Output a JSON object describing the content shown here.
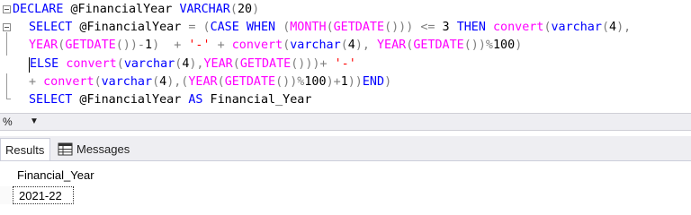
{
  "editor": {
    "lines": [
      [
        {
          "t": "DECLARE",
          "c": "kw"
        },
        {
          "t": " @FinancialYear ",
          "c": ""
        },
        {
          "t": "VARCHAR",
          "c": "kw"
        },
        {
          "t": "(",
          "c": "op"
        },
        {
          "t": "20",
          "c": ""
        },
        {
          "t": ")",
          "c": "op"
        }
      ],
      [
        {
          "t": "SELECT",
          "c": "kw"
        },
        {
          "t": " @FinancialYear ",
          "c": ""
        },
        {
          "t": "=",
          "c": "op"
        },
        {
          "t": " ",
          "c": ""
        },
        {
          "t": "(",
          "c": "op"
        },
        {
          "t": "CASE WHEN",
          "c": "kw"
        },
        {
          "t": " ",
          "c": ""
        },
        {
          "t": "(",
          "c": "op"
        },
        {
          "t": "MONTH",
          "c": "fn"
        },
        {
          "t": "(",
          "c": "op"
        },
        {
          "t": "GETDATE",
          "c": "fn"
        },
        {
          "t": "()))",
          "c": "op"
        },
        {
          "t": " ",
          "c": ""
        },
        {
          "t": "<=",
          "c": "op"
        },
        {
          "t": " 3 ",
          "c": ""
        },
        {
          "t": "THEN",
          "c": "kw"
        },
        {
          "t": " ",
          "c": ""
        },
        {
          "t": "convert",
          "c": "fn"
        },
        {
          "t": "(",
          "c": "op"
        },
        {
          "t": "varchar",
          "c": "kw"
        },
        {
          "t": "(",
          "c": "op"
        },
        {
          "t": "4",
          "c": ""
        },
        {
          "t": "),",
          "c": "op"
        }
      ],
      [
        {
          "t": "YEAR",
          "c": "fn"
        },
        {
          "t": "(",
          "c": "op"
        },
        {
          "t": "GETDATE",
          "c": "fn"
        },
        {
          "t": "())-",
          "c": "op"
        },
        {
          "t": "1",
          "c": ""
        },
        {
          "t": ")",
          "c": "op"
        },
        {
          "t": "  ",
          "c": ""
        },
        {
          "t": "+",
          "c": "op"
        },
        {
          "t": " ",
          "c": ""
        },
        {
          "t": "'-'",
          "c": "str"
        },
        {
          "t": " ",
          "c": ""
        },
        {
          "t": "+",
          "c": "op"
        },
        {
          "t": " ",
          "c": ""
        },
        {
          "t": "convert",
          "c": "fn"
        },
        {
          "t": "(",
          "c": "op"
        },
        {
          "t": "varchar",
          "c": "kw"
        },
        {
          "t": "(",
          "c": "op"
        },
        {
          "t": "4",
          "c": ""
        },
        {
          "t": "),",
          "c": "op"
        },
        {
          "t": " ",
          "c": ""
        },
        {
          "t": "YEAR",
          "c": "fn"
        },
        {
          "t": "(",
          "c": "op"
        },
        {
          "t": "GETDATE",
          "c": "fn"
        },
        {
          "t": "())%",
          "c": "op"
        },
        {
          "t": "100",
          "c": ""
        },
        {
          "t": ")",
          "c": "op"
        }
      ],
      [
        {
          "t": "ELSE",
          "c": "kw"
        },
        {
          "t": " ",
          "c": ""
        },
        {
          "t": "convert",
          "c": "fn"
        },
        {
          "t": "(",
          "c": "op"
        },
        {
          "t": "varchar",
          "c": "kw"
        },
        {
          "t": "(",
          "c": "op"
        },
        {
          "t": "4",
          "c": ""
        },
        {
          "t": "),",
          "c": "op"
        },
        {
          "t": "YEAR",
          "c": "fn"
        },
        {
          "t": "(",
          "c": "op"
        },
        {
          "t": "GETDATE",
          "c": "fn"
        },
        {
          "t": "()))+",
          "c": "op"
        },
        {
          "t": " ",
          "c": ""
        },
        {
          "t": "'-'",
          "c": "str"
        }
      ],
      [
        {
          "t": "+",
          "c": "op"
        },
        {
          "t": " ",
          "c": ""
        },
        {
          "t": "convert",
          "c": "fn"
        },
        {
          "t": "(",
          "c": "op"
        },
        {
          "t": "varchar",
          "c": "kw"
        },
        {
          "t": "(",
          "c": "op"
        },
        {
          "t": "4",
          "c": ""
        },
        {
          "t": "),(",
          "c": "op"
        },
        {
          "t": "YEAR",
          "c": "fn"
        },
        {
          "t": "(",
          "c": "op"
        },
        {
          "t": "GETDATE",
          "c": "fn"
        },
        {
          "t": "())%",
          "c": "op"
        },
        {
          "t": "100",
          "c": ""
        },
        {
          "t": ")+",
          "c": "op"
        },
        {
          "t": "1",
          "c": ""
        },
        {
          "t": "))",
          "c": "op"
        },
        {
          "t": "END",
          "c": "kw"
        },
        {
          "t": ")",
          "c": "op"
        }
      ],
      [
        {
          "t": "SELECT",
          "c": "kw"
        },
        {
          "t": " @FinancialYear ",
          "c": ""
        },
        {
          "t": "AS",
          "c": "kw"
        },
        {
          "t": " Financial_Year",
          "c": ""
        }
      ]
    ]
  },
  "zoom": {
    "value": "%",
    "arrow_icon": "dropdown-arrow-icon"
  },
  "tabs": {
    "results_label": "Results",
    "messages_label": "Messages",
    "messages_icon": "messages-grid-icon"
  },
  "grid": {
    "column_header": "Financial_Year",
    "rows": [
      "2021-22"
    ]
  },
  "colors": {
    "keyword": "#0000ff",
    "function": "#ff00ff",
    "string": "#ff0000",
    "operator": "#808080"
  }
}
